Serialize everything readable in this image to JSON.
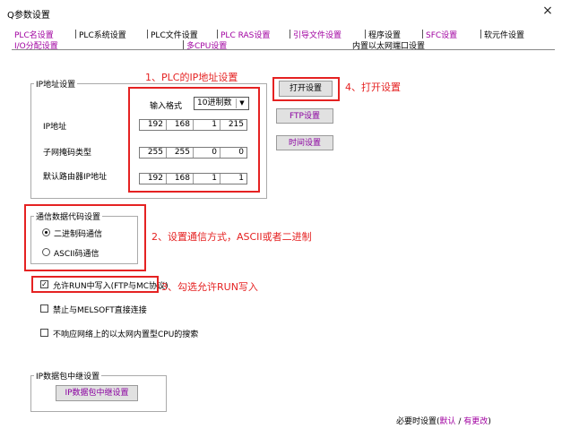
{
  "window": {
    "title": "Q参数设置",
    "close_symbol": "×"
  },
  "tabs_row1": [
    "PLC名设置",
    "PLC系统设置",
    "PLC文件设置",
    "PLC RAS设置",
    "引导文件设置",
    "程序设置",
    "SFC设置",
    "软元件设置"
  ],
  "tabs_row2": [
    "I/O分配设置",
    "多CPU设置",
    "内置以太网端口设置"
  ],
  "ip_group": {
    "label": "IP地址设置",
    "format_label": "输入格式",
    "format_value": "10进制数",
    "ip_label": "IP地址",
    "ip_value": [
      "192",
      "168",
      "1",
      "215"
    ],
    "subnet_label": "子网掩码类型",
    "subnet_value": [
      "255",
      "255",
      "0",
      "0"
    ],
    "gateway_label": "默认路由器IP地址",
    "gateway_value": [
      "192",
      "168",
      "1",
      "1"
    ]
  },
  "buttons": {
    "open": "打开设置",
    "ftp": "FTP设置",
    "time": "时间设置",
    "relay": "IP数据包中继设置"
  },
  "comm_group": {
    "label": "通信数据代码设置",
    "binary": "二进制码通信",
    "ascii": "ASCII码通信"
  },
  "checkboxes": {
    "allow_run": "允许RUN中写入(FTP与MC协议)",
    "forbid_melsoft": "禁止与MELSOFT直接连接",
    "no_search": "不响应网络上的以太网内置型CPU的搜索"
  },
  "relay_group": {
    "label": "IP数据包中继设置"
  },
  "footer": {
    "prefix": "必要时设置(",
    "default": "默认",
    "sep": " / ",
    "changed": "有更改",
    "suffix": ")"
  },
  "annotations": {
    "a1": "1、PLC的IP地址设置",
    "a2": "2、设置通信方式，ASCII或者二进制",
    "a3": "3、勾选允许RUN写入",
    "a4": "4、打开设置"
  },
  "colors": {
    "annotation_red": "#e52222",
    "tab_purple": "#a000a0"
  }
}
